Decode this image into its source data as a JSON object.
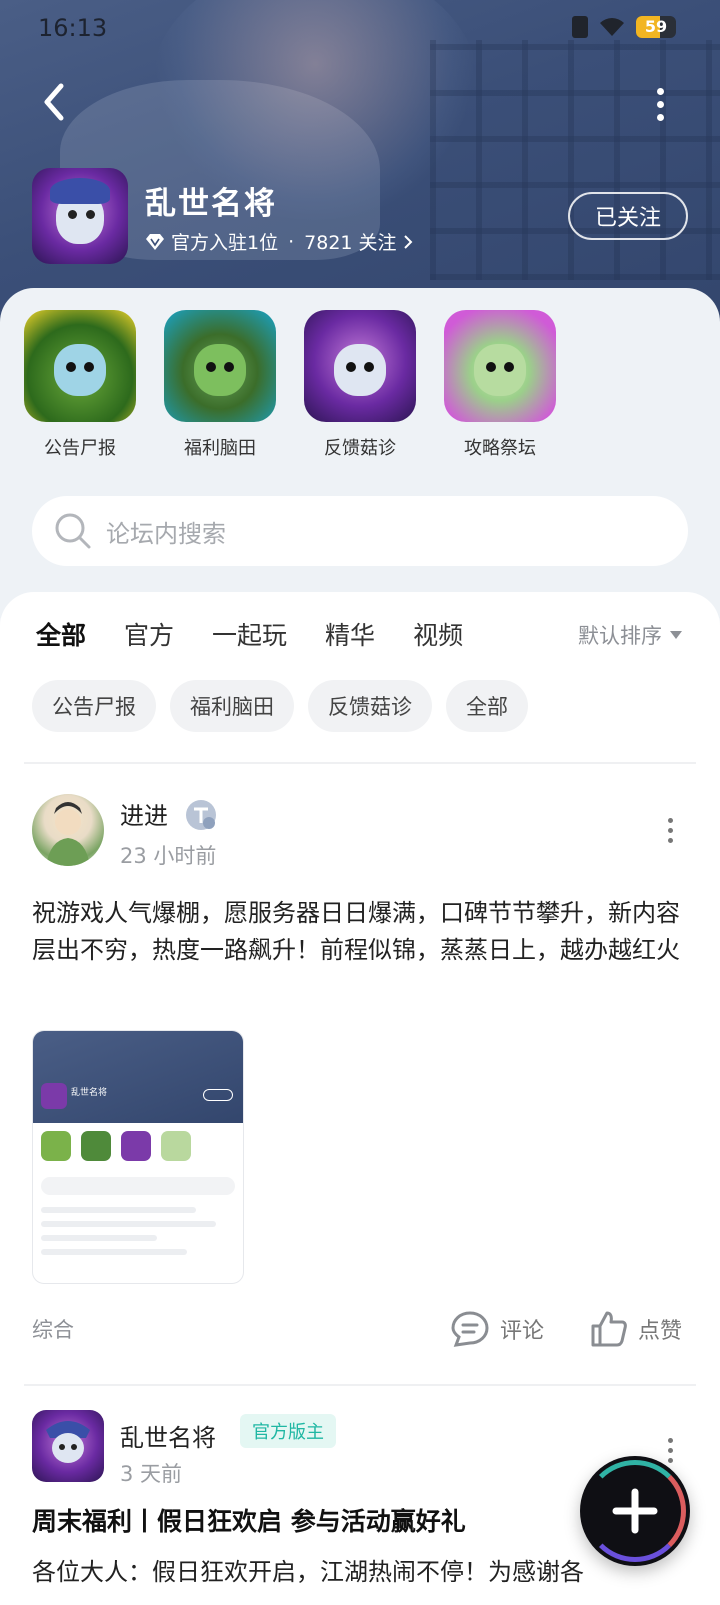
{
  "status_bar": {
    "time": "16:13",
    "battery": "59",
    "battery_level": 0.59
  },
  "header": {
    "title": "乱世名将",
    "official": "官方入驻1位",
    "separator": "·",
    "followers": "7821 关注",
    "follow_button": "已关注"
  },
  "sub_forums": [
    {
      "label": "公告尸报"
    },
    {
      "label": "福利脑田"
    },
    {
      "label": "反馈菇诊"
    },
    {
      "label": "攻略祭坛"
    }
  ],
  "search": {
    "placeholder": "论坛内搜索"
  },
  "tabs": [
    "全部",
    "官方",
    "一起玩",
    "精华",
    "视频"
  ],
  "sort": {
    "label": "默认排序"
  },
  "chips": [
    "公告尸报",
    "福利脑田",
    "反馈菇诊",
    "全部"
  ],
  "posts": [
    {
      "author": "进进",
      "time": "23 小时前",
      "text": "祝游戏人气爆棚，愿服务器日日爆满，口碑节节攀升，新内容层出不穷，热度一路飙升！前程似锦，蒸蒸日上，越办越红火",
      "category": "综合",
      "comment_label": "评论",
      "like_label": "点赞"
    },
    {
      "author": "乱世名将",
      "badge": "官方版主",
      "time": "3 天前",
      "title": "周末福利丨假日狂欢启 参与活动赢好礼",
      "text": "各位大人：假日狂欢开启，江湖热闹不停！为感谢各"
    }
  ]
}
